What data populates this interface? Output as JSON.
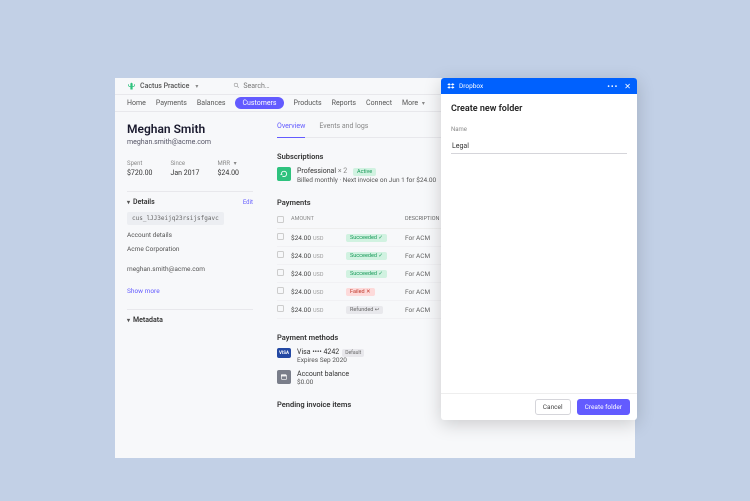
{
  "brand": {
    "name": "Cactus Practice"
  },
  "search": {
    "placeholder": "Search…"
  },
  "nav": {
    "home": "Home",
    "payments": "Payments",
    "balances": "Balances",
    "customers": "Customers",
    "products": "Products",
    "reports": "Reports",
    "connect": "Connect",
    "more": "More"
  },
  "customer": {
    "name": "Meghan Smith",
    "email": "meghan.smith@acme.com"
  },
  "stats": {
    "spent_label": "Spent",
    "spent_value": "$720.00",
    "since_label": "Since",
    "since_value": "Jan 2017",
    "mrr_label": "MRR",
    "mrr_value": "$24.00"
  },
  "details": {
    "title": "Details",
    "edit": "Edit",
    "code": "cus_lJJ3eijq23rsijsfgavc",
    "line1": "Account details",
    "line2": "Acme Corporation",
    "line3": "meghan.smith@acme.com",
    "show_more": "Show more"
  },
  "metadata": {
    "title": "Metadata"
  },
  "tabs": {
    "overview": "Overview",
    "events": "Events and logs"
  },
  "subs": {
    "title": "Subscriptions",
    "plan_name": "Professional",
    "plan_qty": "× 2",
    "active": "Active",
    "sub_line": "Billed monthly  ·   Next invoice on Jun 1 for $24.00"
  },
  "payments": {
    "title": "Payments",
    "col_amount": "AMOUNT",
    "col_desc": "DESCRIPTION",
    "rows": [
      {
        "amount": "$24.00",
        "ccy": "USD",
        "status": "Succeeded",
        "status_kind": "succeeded",
        "desc": "For   ACM"
      },
      {
        "amount": "$24.00",
        "ccy": "USD",
        "status": "Succeeded",
        "status_kind": "succeeded",
        "desc": "For   ACM"
      },
      {
        "amount": "$24.00",
        "ccy": "USD",
        "status": "Succeeded",
        "status_kind": "succeeded",
        "desc": "For   ACM"
      },
      {
        "amount": "$24.00",
        "ccy": "USD",
        "status": "Failed",
        "status_kind": "failed",
        "desc": "For   ACM"
      },
      {
        "amount": "$24.00",
        "ccy": "USD",
        "status": "Refunded",
        "status_kind": "refunded",
        "desc": "For   ACM"
      }
    ]
  },
  "pm": {
    "title": "Payment methods",
    "visa_line": "Visa •••• 4242",
    "default": "Default",
    "visa_exp": "Expires Sep 2020",
    "bal_title": "Account balance",
    "bal_val": "$0.00"
  },
  "pending": {
    "title": "Pending invoice items"
  },
  "modal": {
    "app": "Dropbox",
    "title": "Create new folder",
    "name_label": "Name",
    "name_value": "Legal",
    "cancel": "Cancel",
    "create": "Create folder"
  }
}
